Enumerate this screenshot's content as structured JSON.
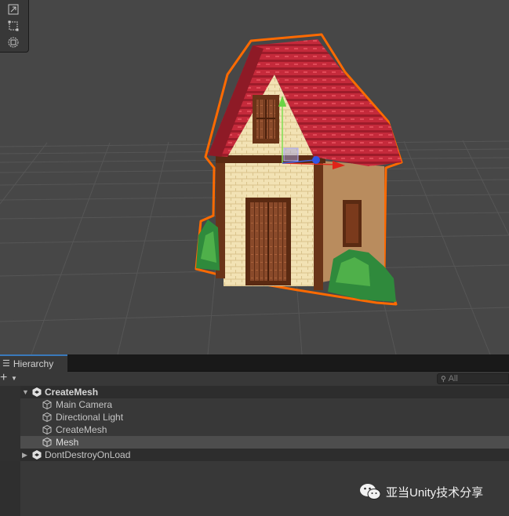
{
  "scene_view": {
    "tools": [
      {
        "name": "move-view-tool"
      },
      {
        "name": "rect-tool"
      },
      {
        "name": "transform-tool"
      }
    ]
  },
  "hierarchy": {
    "tab_label": "Hierarchy",
    "add_symbol": "+",
    "search_placeholder": "All",
    "items": [
      {
        "label": "CreateMesh",
        "kind": "scene",
        "expanded": true
      },
      {
        "label": "Main Camera",
        "kind": "gameobject"
      },
      {
        "label": "Directional Light",
        "kind": "gameobject"
      },
      {
        "label": "CreateMesh",
        "kind": "gameobject"
      },
      {
        "label": "Mesh",
        "kind": "gameobject",
        "selected": true
      },
      {
        "label": "DontDestroyOnLoad",
        "kind": "scene",
        "expanded": false
      }
    ]
  },
  "watermark": {
    "text": "亚当Unity技术分享"
  },
  "colors": {
    "selection_outline": "#ff6a00",
    "roof": "#c8283a",
    "tab_accent": "#3a79bb",
    "scene_bg": "#474747"
  }
}
